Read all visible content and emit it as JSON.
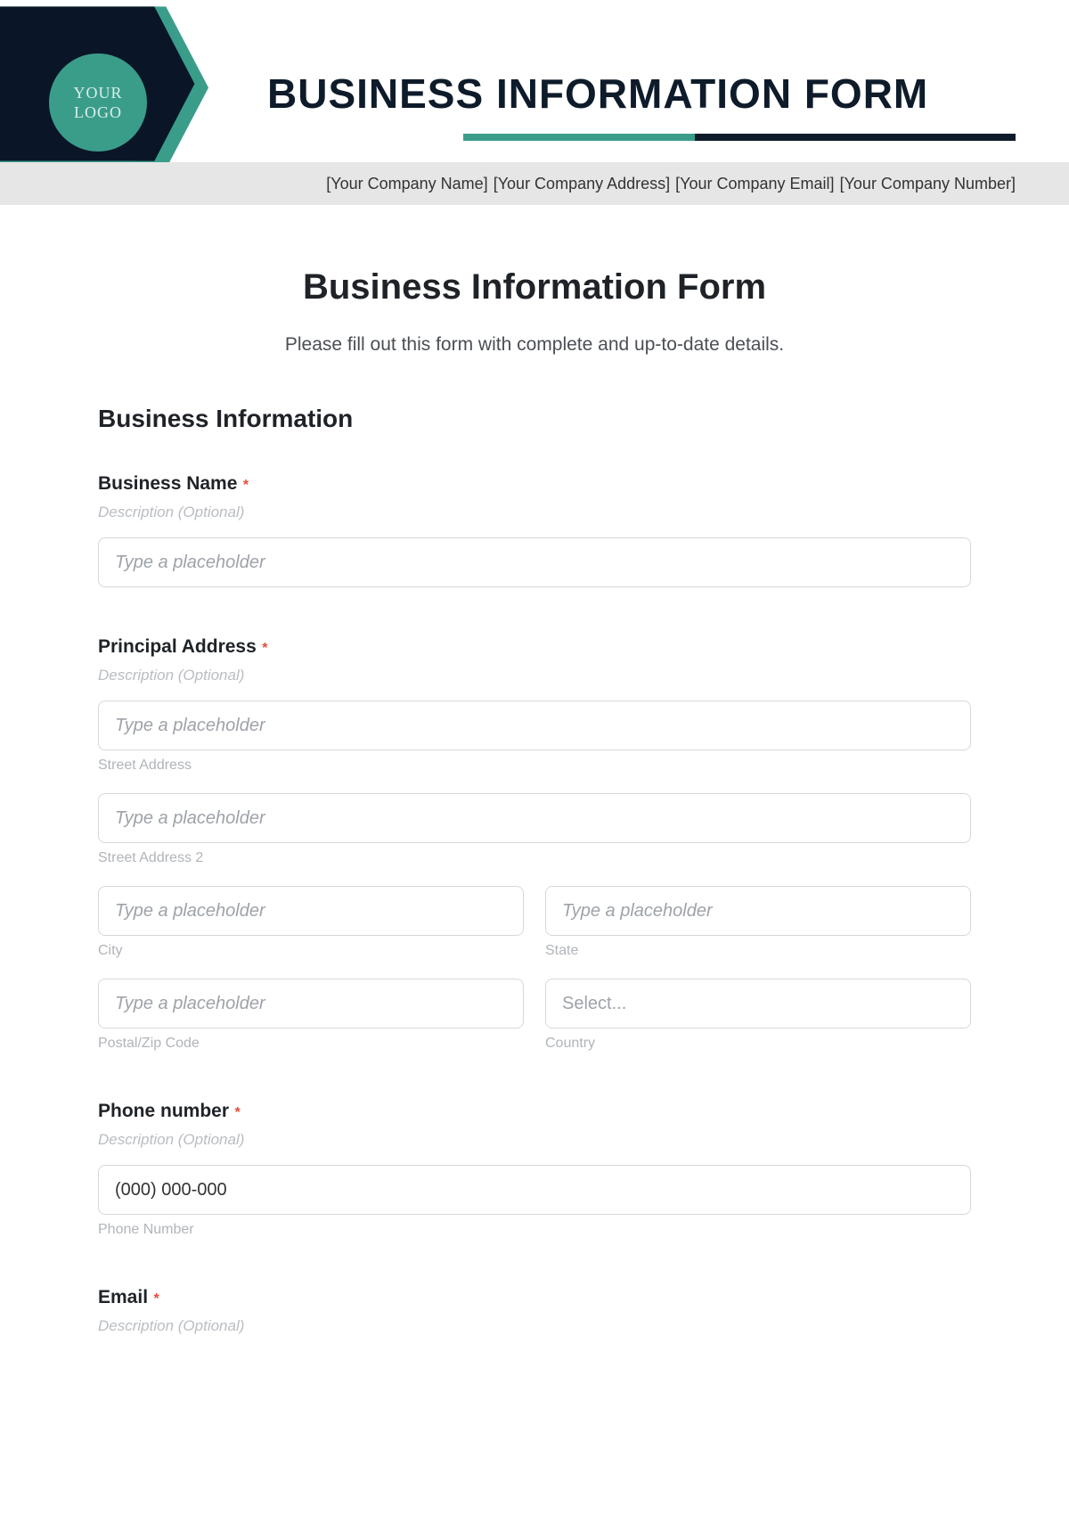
{
  "banner": {
    "logo_line1": "YOUR",
    "logo_line2": "LOGO",
    "title": "BUSINESS INFORMATION FORM",
    "strip": {
      "company_name": "[Your Company Name]",
      "company_address": "[Your Company Address]",
      "company_email": "[Your Company Email]",
      "company_number": "[Your Company Number]"
    }
  },
  "form": {
    "title": "Business Information Form",
    "subtitle": "Please fill out this form with complete and up-to-date details.",
    "section_heading": "Business Information",
    "description_placeholder": "Description (Optional)",
    "input_placeholder": "Type a placeholder",
    "select_placeholder": "Select...",
    "required_mark": "*",
    "fields": {
      "business_name": {
        "label": "Business Name"
      },
      "principal_address": {
        "label": "Principal Address",
        "street1": "Street Address",
        "street2": "Street Address 2",
        "city": "City",
        "state": "State",
        "postal": "Postal/Zip Code",
        "country": "Country"
      },
      "phone": {
        "label": "Phone number",
        "value": "(000) 000-000",
        "sub": "Phone Number"
      },
      "email": {
        "label": "Email"
      }
    }
  }
}
